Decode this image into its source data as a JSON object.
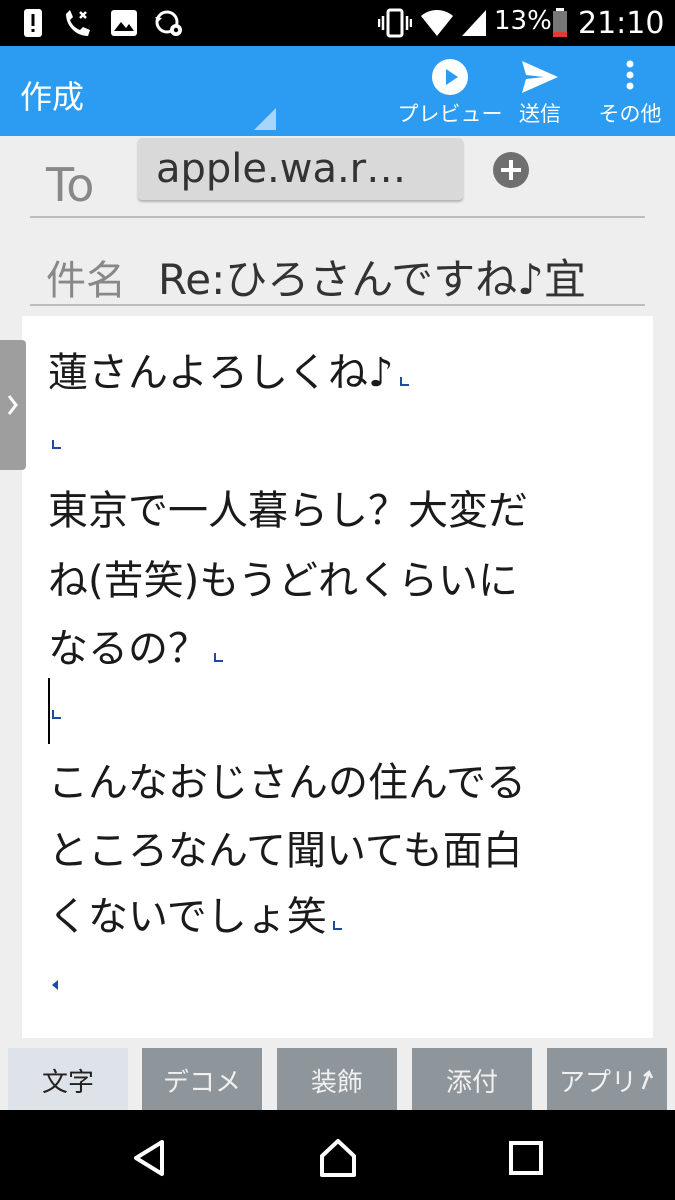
{
  "status_bar": {
    "battery_percent": "13%",
    "time": "21:10",
    "icons": [
      "alert-icon",
      "missed-call-icon",
      "image-icon",
      "settings-sync-icon",
      "vibrate-icon",
      "wifi-icon",
      "signal-icon",
      "battery-icon"
    ]
  },
  "app_bar": {
    "title": "作成",
    "actions": [
      {
        "label": "プレビュー",
        "icon": "play-circle-icon"
      },
      {
        "label": "送信",
        "icon": "send-icon"
      },
      {
        "label": "その他",
        "icon": "more-vert-icon"
      }
    ]
  },
  "header": {
    "to_label": "To",
    "to_chip": "apple.wa.r…",
    "subject_label": "件名",
    "subject_value": "Re:ひろさんですね♪宜"
  },
  "body": {
    "lines": [
      "蓮さんよろしくね♪",
      "",
      "東京で一人暮らし？大変だ",
      "ね(苦笑)もうどれくらいに",
      "なるの？",
      "",
      "こんなおじさんの住んでる",
      "ところなんて聞いても面白",
      "くないでしょ笑",
      ""
    ]
  },
  "bottom_tabs": [
    {
      "label": "文字",
      "active": true
    },
    {
      "label": "デコメ",
      "active": false
    },
    {
      "label": "装飾",
      "active": false
    },
    {
      "label": "添付",
      "active": false
    },
    {
      "label": "アプリ",
      "active": false
    }
  ],
  "colors": {
    "accent": "#2b9cf2",
    "status_bar": "#000000",
    "body": "#ffffff",
    "tab_inactive": "#8f969b",
    "return_mark": "#1f4aa0"
  }
}
